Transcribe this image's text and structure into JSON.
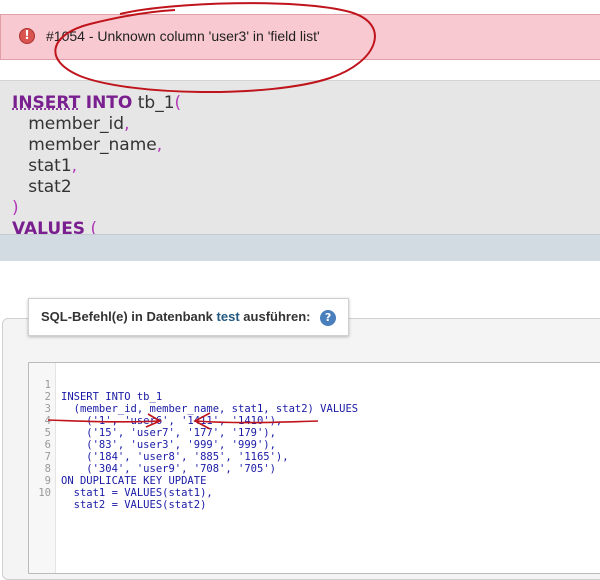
{
  "error": {
    "message": "#1054 - Unknown column 'user3' in 'field list'"
  },
  "query_preview": {
    "kw_insert": "INSERT",
    "kw_into": "INTO",
    "table": "tb_1",
    "open_paren": "(",
    "columns": [
      "member_id",
      "member_name",
      "stat1",
      "stat2"
    ],
    "comma": ",",
    "close_paren": ")",
    "kw_values": "VALUES",
    "values_paren": "("
  },
  "run_panel": {
    "legend_prefix": "SQL-Befehl(e) in Datenbank",
    "database": "test",
    "legend_suffix": "ausführen:",
    "help_icon": "help-icon"
  },
  "editor": {
    "lines": [
      {
        "n": "1",
        "text": "INSERT INTO tb_1"
      },
      {
        "n": "2",
        "text": "  (member_id, member_name, stat1, stat2) VALUES"
      },
      {
        "n": "3",
        "text": "    ('1', 'user6', '1411', '1410'),"
      },
      {
        "n": "4",
        "text": "    ('15', 'user7', '177', '179'),"
      },
      {
        "n": "5",
        "text": "    ('83', 'user3', '999', '999'),"
      },
      {
        "n": "6",
        "text": "    ('184', 'user8', '885', '1165'),"
      },
      {
        "n": "7",
        "text": "    ('304', 'user9', '708', '705')"
      },
      {
        "n": "8",
        "text": "ON DUPLICATE KEY UPDATE"
      },
      {
        "n": "9",
        "text": "  stat1 = VALUES(stat1),"
      },
      {
        "n": "10",
        "text": "  stat2 = VALUES(stat2)"
      }
    ]
  },
  "colors": {
    "error_bg": "#f8c9d0",
    "keyword": "#7a1f8f",
    "annotation": "#c0141c"
  }
}
